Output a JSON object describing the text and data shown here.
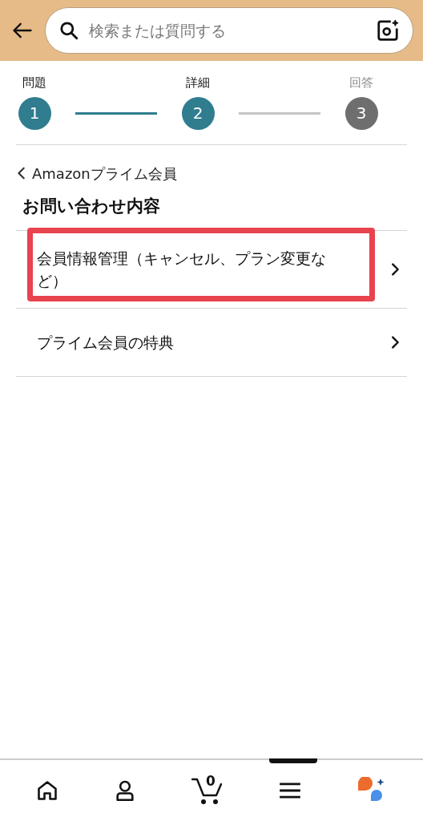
{
  "search": {
    "placeholder": "検索または質問する"
  },
  "steps": [
    {
      "label": "問題",
      "number": "1",
      "reached": true
    },
    {
      "label": "詳細",
      "number": "2",
      "reached": true
    },
    {
      "label": "回答",
      "number": "3",
      "reached": false
    }
  ],
  "breadcrumb": "Amazonプライム会員",
  "heading": "お問い合わせ内容",
  "items": [
    {
      "label": "会員情報管理（キャンセル、プラン変更など）",
      "highlighted": true
    },
    {
      "label": "プライム会員の特典",
      "highlighted": false
    }
  ],
  "bottom_nav": {
    "cart_count": "0"
  }
}
